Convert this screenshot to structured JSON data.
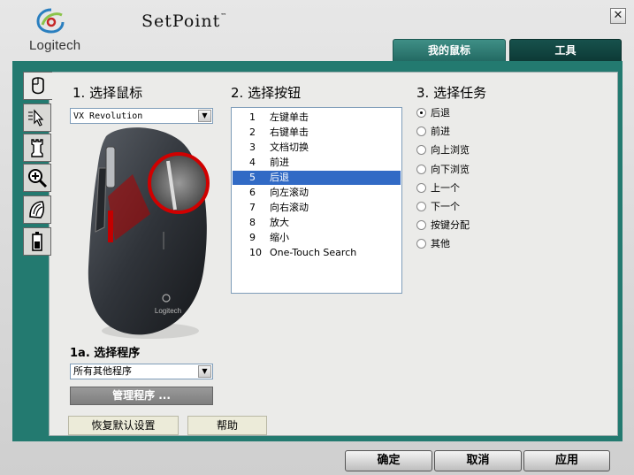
{
  "header": {
    "logo_text": "Logitech",
    "app_title": "SetPoint",
    "trademark": "™"
  },
  "tabs": [
    {
      "label": "我的鼠标",
      "active": true
    },
    {
      "label": "工具",
      "active": false
    }
  ],
  "sidebar": {
    "items": [
      {
        "icon": "mouse-icon",
        "active": true
      },
      {
        "icon": "pointer-speed-icon",
        "active": false
      },
      {
        "icon": "chess-rook-icon",
        "active": false
      },
      {
        "icon": "zoom-icon",
        "active": false
      },
      {
        "icon": "scroll-wheel-icon",
        "active": false
      },
      {
        "icon": "battery-icon",
        "active": false
      }
    ]
  },
  "section1": {
    "title": "1. 选择鼠标",
    "mouse_select": "VX Revolution",
    "subtitle": "1a. 选择程序",
    "program_select": "所有其他程序",
    "manage_button": "管理程序 ...",
    "mouse_brand": "Logitech"
  },
  "section2": {
    "title": "2. 选择按钮",
    "selected_index": 4,
    "items": [
      {
        "num": "1",
        "label": "左键单击"
      },
      {
        "num": "2",
        "label": "右键单击"
      },
      {
        "num": "3",
        "label": "文档切换"
      },
      {
        "num": "4",
        "label": "前进"
      },
      {
        "num": "5",
        "label": "后退"
      },
      {
        "num": "6",
        "label": "向左滚动"
      },
      {
        "num": "7",
        "label": "向右滚动"
      },
      {
        "num": "8",
        "label": "放大"
      },
      {
        "num": "9",
        "label": "缩小"
      },
      {
        "num": "10",
        "label": "One-Touch Search"
      }
    ]
  },
  "section3": {
    "title": "3. 选择任务",
    "selected_index": 0,
    "options": [
      "后退",
      "前进",
      "向上浏览",
      "向下浏览",
      "上一个",
      "下一个",
      "按键分配",
      "其他"
    ]
  },
  "footer_left": {
    "restore_defaults": "恢复默认设置",
    "help": "帮助"
  },
  "dialog_buttons": {
    "ok": "确定",
    "cancel": "取消",
    "apply": "应用"
  },
  "colors": {
    "frame_teal": "#237a70",
    "selection_blue": "#316ac5"
  }
}
